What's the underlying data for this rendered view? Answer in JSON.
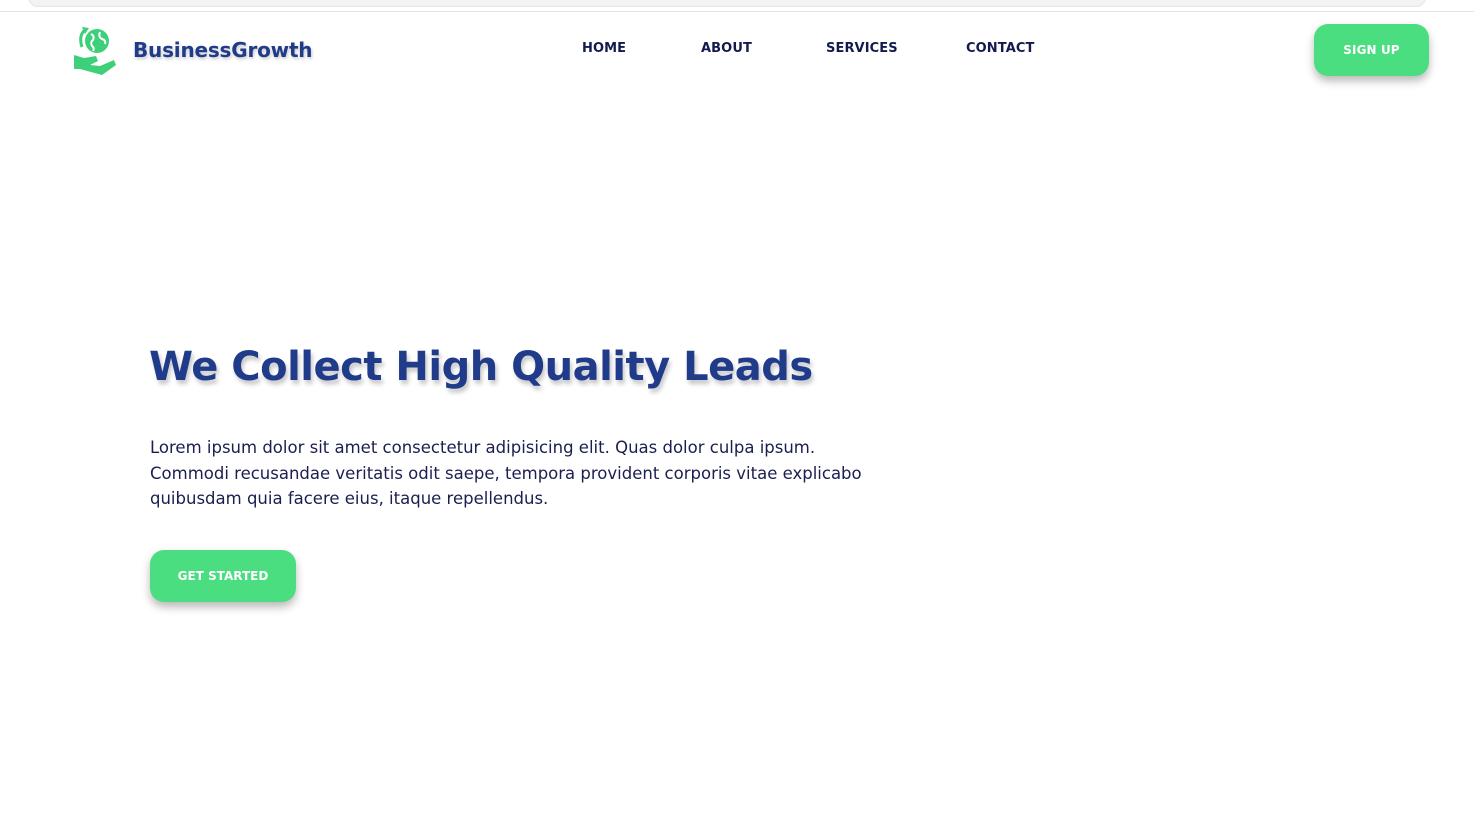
{
  "colors": {
    "brand_blue": "#1f3b8a",
    "nav_text": "#131a4d",
    "accent_green": "#4ade80",
    "body_text": "#1a1f4f",
    "background": "#ffffff"
  },
  "header": {
    "logo_icon": "globe-in-hand-icon",
    "brand_name": "BusinessGrowth",
    "nav": [
      {
        "label": "HOME"
      },
      {
        "label": "ABOUT"
      },
      {
        "label": "SERVICES"
      },
      {
        "label": "CONTACT"
      }
    ],
    "signup_label": "SIGN UP"
  },
  "hero": {
    "title": "We Collect High Quality Leads",
    "description": "Lorem ipsum dolor sit amet consectetur adipisicing elit. Quas dolor culpa ipsum. Commodi recusandae veritatis odit saepe, tempora provident corporis vitae explicabo quibusdam quia facere eius, itaque repellendus.",
    "cta_label": "GET STARTED"
  }
}
